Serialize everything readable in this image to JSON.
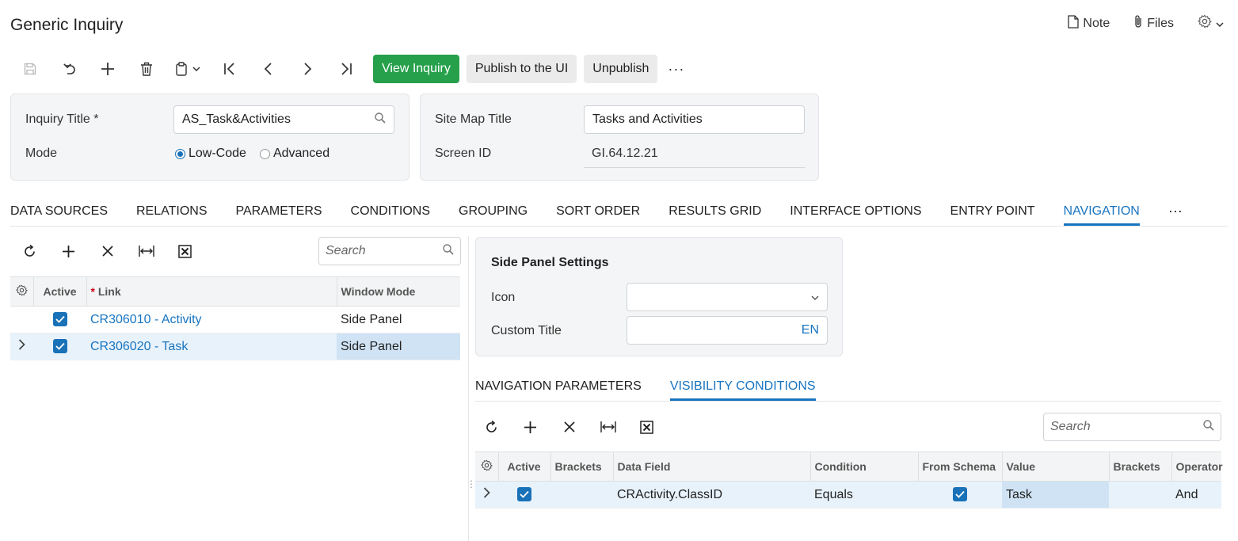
{
  "page": {
    "title": "Generic Inquiry"
  },
  "top_actions": {
    "note": "Note",
    "files": "Files"
  },
  "toolbar": {
    "icons": [
      "save-icon",
      "undo-icon",
      "add-icon",
      "delete-icon",
      "clipboard-icon",
      "first-icon",
      "prev-icon",
      "next-icon",
      "last-icon"
    ],
    "view_inquiry": "View Inquiry",
    "publish": "Publish to the UI",
    "unpublish": "Unpublish",
    "more": "···"
  },
  "summary": {
    "inquiry_title_label": "Inquiry Title *",
    "inquiry_title_value": "AS_Task&Activities",
    "mode_label": "Mode",
    "mode_options": [
      "Low-Code",
      "Advanced"
    ],
    "mode_selected": "Low-Code",
    "site_map_title_label": "Site Map Title",
    "site_map_title_value": "Tasks and Activities",
    "screen_id_label": "Screen ID",
    "screen_id_value": "GI.64.12.21"
  },
  "main_tabs": [
    "DATA SOURCES",
    "RELATIONS",
    "PARAMETERS",
    "CONDITIONS",
    "GROUPING",
    "SORT ORDER",
    "RESULTS GRID",
    "INTERFACE OPTIONS",
    "ENTRY POINT",
    "NAVIGATION"
  ],
  "main_tab_active": "NAVIGATION",
  "main_tabs_more": "···",
  "nav_grid": {
    "search_placeholder": "Search",
    "columns": [
      "Active",
      "Link",
      "Window Mode"
    ],
    "link_required_marker": "*",
    "rows": [
      {
        "active": true,
        "link": "CR306010 - Activity",
        "window_mode": "Side Panel",
        "selected": false
      },
      {
        "active": true,
        "link": "CR306020 - Task",
        "window_mode": "Side Panel",
        "selected": true
      }
    ]
  },
  "side_panel": {
    "title": "Side Panel Settings",
    "icon_label": "Icon",
    "icon_value": "",
    "custom_title_label": "Custom Title",
    "custom_title_value": "",
    "lang_code": "EN"
  },
  "sub_tabs": [
    "NAVIGATION PARAMETERS",
    "VISIBILITY CONDITIONS"
  ],
  "sub_tab_active": "VISIBILITY CONDITIONS",
  "vis_grid": {
    "search_placeholder": "Search",
    "columns": [
      "Active",
      "Brackets",
      "Data Field",
      "Condition",
      "From Schema",
      "Value",
      "Brackets",
      "Operator"
    ],
    "rows": [
      {
        "active": true,
        "brackets_open": "",
        "data_field": "CRActivity.ClassID",
        "condition": "Equals",
        "from_schema": true,
        "value": "Task",
        "brackets_close": "",
        "operator": "And"
      }
    ]
  },
  "colors": {
    "accent": "#1874c0",
    "primary_button": "#26a04b",
    "checkbox": "#1971b8"
  }
}
